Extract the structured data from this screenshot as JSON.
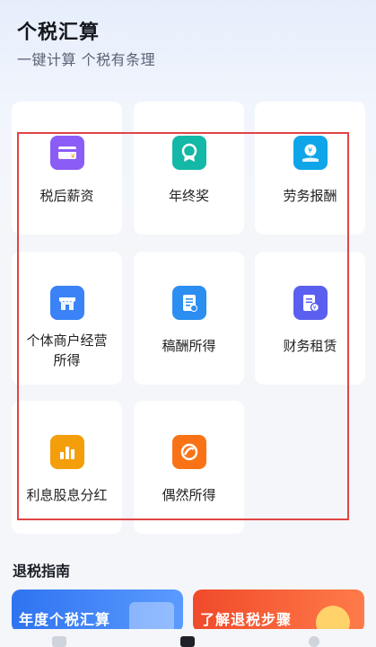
{
  "header": {
    "title": "个税汇算",
    "subtitle": "一键计算 个税有条理"
  },
  "tools": [
    {
      "label": "税后薪资",
      "icon": "wallet-icon",
      "color": "#8b5cf6"
    },
    {
      "label": "年终奖",
      "icon": "medal-icon",
      "color": "#14b8a6"
    },
    {
      "label": "劳务报酬",
      "icon": "coin-hand-icon",
      "color": "#0ea5e9"
    },
    {
      "label": "个体商户经营所得",
      "label_line1": "个体商户经营",
      "label_line2": "所得",
      "icon": "shop-icon",
      "color": "#3b82f6"
    },
    {
      "label": "稿酬所得",
      "icon": "document-icon",
      "color": "#2b8ef0"
    },
    {
      "label": "财务租赁",
      "icon": "ledger-icon",
      "color": "#5b5ff0"
    },
    {
      "label": "利息股息分红",
      "icon": "bar-chart-icon",
      "color": "#f59e0b"
    },
    {
      "label": "偶然所得",
      "icon": "lucky-icon",
      "color": "#f97316"
    }
  ],
  "guide": {
    "title": "退税指南",
    "banner_left": "年度个税汇算",
    "banner_right": "了解退税步骤"
  },
  "colors": {
    "highlight": "#e04545"
  }
}
